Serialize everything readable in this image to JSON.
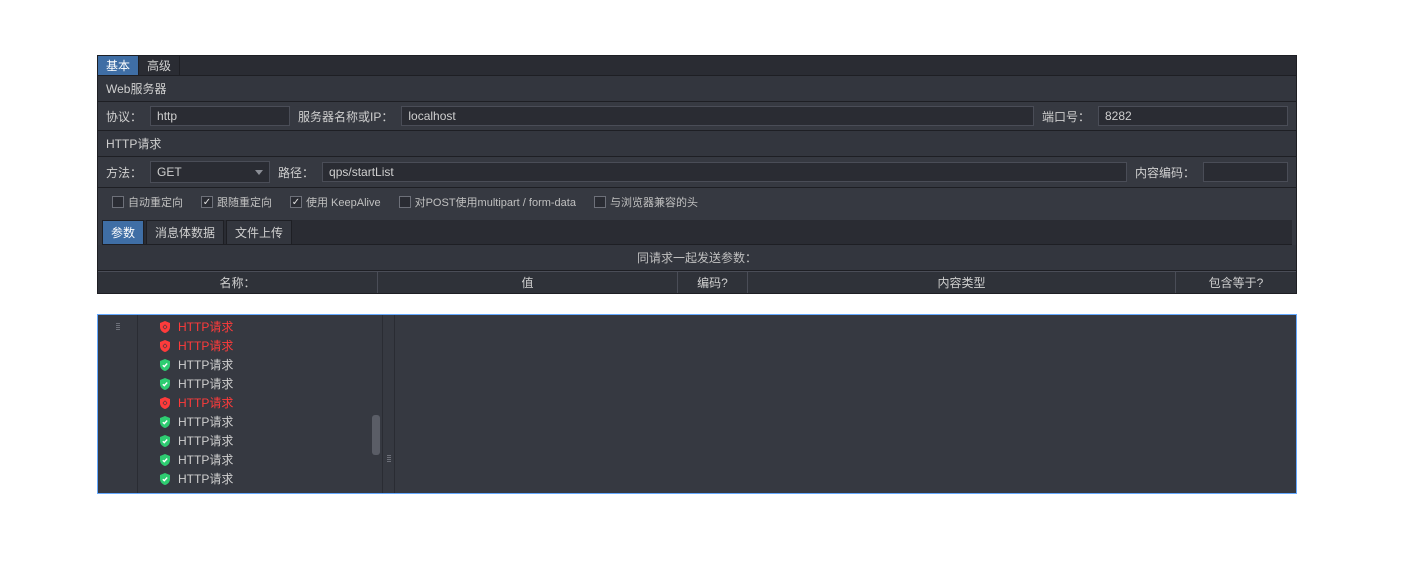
{
  "tabs_top": {
    "basic": "基本",
    "advanced": "高级"
  },
  "web_server": {
    "title": "Web服务器",
    "protocol_label": "协议：",
    "protocol_value": "http",
    "server_label": "服务器名称或IP：",
    "server_value": "localhost",
    "port_label": "端口号：",
    "port_value": "8282"
  },
  "http_request": {
    "title": "HTTP请求",
    "method_label": "方法：",
    "method_value": "GET",
    "path_label": "路径：",
    "path_value": "qps/startList",
    "encoding_label": "内容编码：",
    "encoding_value": ""
  },
  "checks": {
    "auto_redirect": "自动重定向",
    "follow_redirect": "跟随重定向",
    "keepalive": "使用 KeepAlive",
    "multipart": "对POST使用multipart / form-data",
    "browser_head": "与浏览器兼容的头"
  },
  "subtabs": {
    "params": "参数",
    "body": "消息体数据",
    "files": "文件上传"
  },
  "param_header": "同请求一起发送参数：",
  "param_cols": {
    "name": "名称：",
    "value": "值",
    "encode": "编码?",
    "ctype": "内容类型",
    "include": "包含等于?"
  },
  "tree": {
    "items": [
      {
        "label": "HTTP请求",
        "status": "err"
      },
      {
        "label": "HTTP请求",
        "status": "err"
      },
      {
        "label": "HTTP请求",
        "status": "ok"
      },
      {
        "label": "HTTP请求",
        "status": "ok"
      },
      {
        "label": "HTTP请求",
        "status": "err"
      },
      {
        "label": "HTTP请求",
        "status": "ok"
      },
      {
        "label": "HTTP请求",
        "status": "ok"
      },
      {
        "label": "HTTP请求",
        "status": "ok"
      },
      {
        "label": "HTTP请求",
        "status": "ok"
      }
    ]
  }
}
